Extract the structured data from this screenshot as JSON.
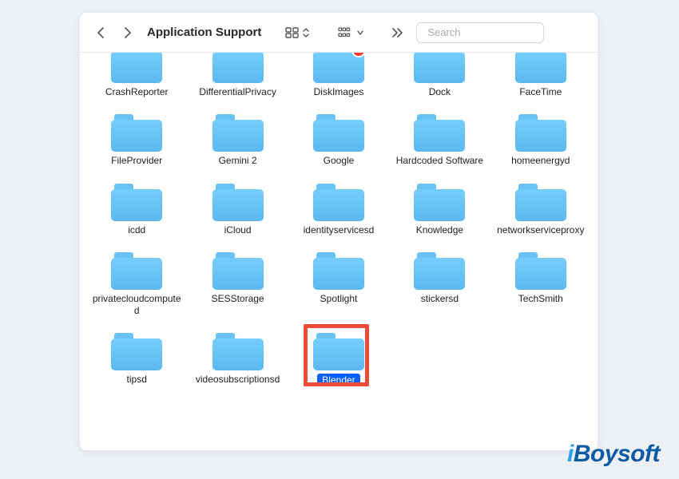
{
  "toolbar": {
    "title": "Application Support",
    "search_placeholder": "Search"
  },
  "folders": [
    {
      "name": "CrashReporter",
      "row": 1
    },
    {
      "name": "DifferentialPrivacy",
      "row": 1
    },
    {
      "name": "DiskImages",
      "row": 1,
      "blocked": true
    },
    {
      "name": "Dock",
      "row": 1
    },
    {
      "name": "FaceTime",
      "row": 1
    },
    {
      "name": "FileProvider"
    },
    {
      "name": "Gemini 2"
    },
    {
      "name": "Google"
    },
    {
      "name": "Hardcoded Software"
    },
    {
      "name": "homeenergyd"
    },
    {
      "name": "icdd"
    },
    {
      "name": "iCloud"
    },
    {
      "name": "identityservicesd"
    },
    {
      "name": "Knowledge"
    },
    {
      "name": "networkserviceproxy"
    },
    {
      "name": "privatecloudcomputed"
    },
    {
      "name": "SESStorage"
    },
    {
      "name": "Spotlight"
    },
    {
      "name": "stickersd"
    },
    {
      "name": "TechSmith"
    },
    {
      "name": "tipsd"
    },
    {
      "name": "videosubscriptionsd"
    },
    {
      "name": "Blender",
      "selected": true,
      "highlighted": true
    }
  ],
  "watermark": {
    "pre": "i",
    "main": "Boysoft"
  }
}
